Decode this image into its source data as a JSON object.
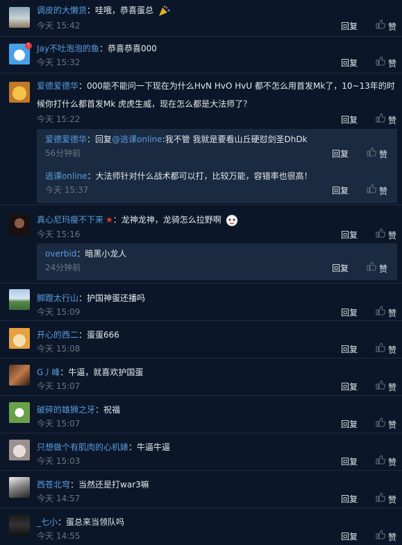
{
  "ui": {
    "reply_label": "回复",
    "like_label": "赞"
  },
  "comments": [
    {
      "user": "调皮的大懒货",
      "text": "哇哦，恭喜蛋总",
      "time": "今天 15:42"
    },
    {
      "user": "Jay不吐泡泡的鱼",
      "text": "恭喜恭喜000",
      "time": "今天 15:32",
      "badge": "!"
    },
    {
      "user": "爱德爱德华",
      "text": "000能不能问一下现在为什么HvN HvO HvU 都不怎么用首发Mk了，10~13年的时候你打什么都首发Mk 虎虎生威，现在怎么都是大法师了？",
      "time": "今天 15:22",
      "replies": [
        {
          "user": "爱德爱德华",
          "prefix": "回复",
          "mention": "@逃课online",
          "text": ":我不管 我就是要看山丘硬怼剑圣DhDk",
          "time": "56分钟前"
        },
        {
          "user": "逃课online",
          "text": "大法师针对什么战术都可以打，比较万能，容错率也很高！",
          "time": "今天 15:37"
        }
      ]
    },
    {
      "user": "真心尼玛瘦不下来",
      "text": "龙神龙神，龙骑怎么拉野啊",
      "time": "今天 15:16",
      "replies": [
        {
          "user": "overbid",
          "text": "暗黑小龙人",
          "time": "24分钟前"
        }
      ]
    },
    {
      "user": "脚蹬太行山",
      "text": "护国神蛋还播吗",
      "time": "今天 15:09"
    },
    {
      "user": "开心的西二",
      "text": "蛋蛋666",
      "time": "今天 15:08"
    },
    {
      "user": "G丿峰",
      "text": "牛逼，就喜欢护国蛋",
      "time": "今天 15:07"
    },
    {
      "user": "破碎的雄狮之牙",
      "text": "祝福",
      "time": "今天 15:07"
    },
    {
      "user": "只想做个有肌肉的心机婊",
      "text": "牛逼牛逼",
      "time": "今天 15:03"
    },
    {
      "user": "西苍北穹",
      "text": "当然还是打war3嘛",
      "time": "今天 14:57"
    },
    {
      "user": "_七小",
      "text": "蛋总来当领队吗",
      "time": "今天 14:55"
    }
  ]
}
